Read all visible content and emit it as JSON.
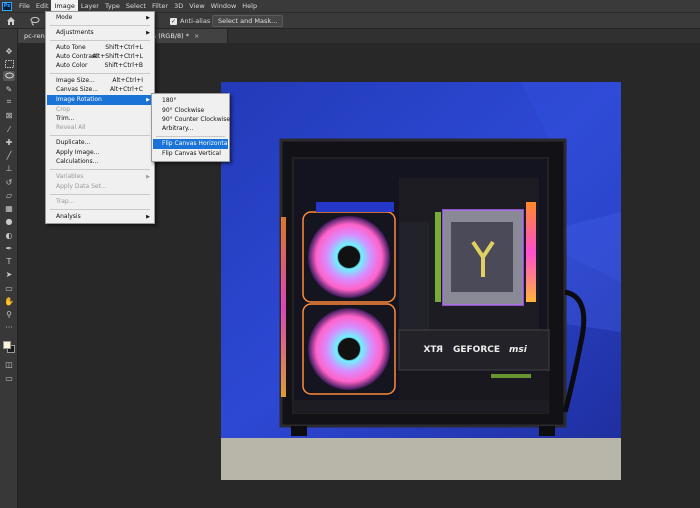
{
  "menubar": {
    "logo": "Ps",
    "items": [
      "File",
      "Edit",
      "Image",
      "Layer",
      "Type",
      "Select",
      "Filter",
      "3D",
      "View",
      "Window",
      "Help"
    ]
  },
  "options": {
    "antialias_label": "Anti-alias",
    "antialias_checked": true,
    "select_mask_label": "Select and Mask..."
  },
  "document_tab": {
    "name_left": "pc-rend",
    "name_right": "% (RGB/8) *",
    "close": "×"
  },
  "image_menu": {
    "mode": "Mode",
    "adjustments": "Adjustments",
    "auto_tone": "Auto Tone",
    "auto_tone_sc": "Shift+Ctrl+L",
    "auto_contrast": "Auto Contrast",
    "auto_contrast_sc": "Alt+Shift+Ctrl+L",
    "auto_color": "Auto Color",
    "auto_color_sc": "Shift+Ctrl+B",
    "image_size": "Image Size...",
    "image_size_sc": "Alt+Ctrl+I",
    "canvas_size": "Canvas Size...",
    "canvas_size_sc": "Alt+Ctrl+C",
    "image_rotation": "Image Rotation",
    "crop": "Crop",
    "trim": "Trim...",
    "reveal_all": "Reveal All",
    "duplicate": "Duplicate...",
    "apply_image": "Apply Image...",
    "calculations": "Calculations...",
    "variables": "Variables",
    "apply_data_set": "Apply Data Set...",
    "trap": "Trap...",
    "analysis": "Analysis"
  },
  "rotation_menu": {
    "r180": "180°",
    "cw90": "90° Clockwise",
    "ccw90": "90° Counter Clockwise",
    "arbitrary": "Arbitrary...",
    "flip_h": "Flip Canvas Horizontal",
    "flip_v": "Flip Canvas Vertical"
  },
  "canvas_image": {
    "gpu_brand_left": "RTX",
    "gpu_brand_mid": "GEFORCE",
    "gpu_brand_right": "msi"
  },
  "colors": {
    "ui_dark": "#282828",
    "menu_bg": "#f0f0f0",
    "highlight": "#1a73d6",
    "backdrop_blue": "#2b3fc4",
    "table_top": "#b8b6a8",
    "rgb_pink": "#ff5ec8",
    "rgb_cyan": "#44f0ff"
  }
}
